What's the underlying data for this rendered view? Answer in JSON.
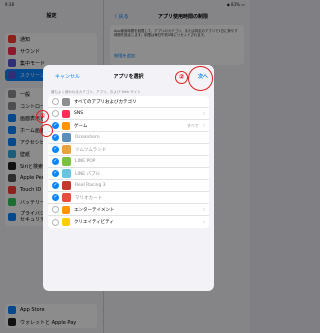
{
  "statusbar": {
    "time": "9:38",
    "right": "◆ 83% ▭"
  },
  "left": {
    "title": "設定",
    "group1": [
      {
        "label": "通知",
        "icon": "bell-icon",
        "color": "#ff3b30"
      },
      {
        "label": "サウンド",
        "icon": "speaker-icon",
        "color": "#ff2d55"
      },
      {
        "label": "集中モード",
        "icon": "moon-icon",
        "color": "#5856d6"
      },
      {
        "label": "スクリーンタイム",
        "icon": "hourglass-icon",
        "color": "#5856d6"
      }
    ],
    "group2": [
      {
        "label": "一般",
        "icon": "gear-icon",
        "color": "#8e8e93"
      },
      {
        "label": "コントロールセンター",
        "icon": "switches-icon",
        "color": "#8e8e93"
      },
      {
        "label": "画面表示と明るさ",
        "icon": "aa-icon",
        "color": "#0a84ff"
      },
      {
        "label": "ホーム画面とDock",
        "icon": "grid-icon",
        "color": "#0a84ff"
      },
      {
        "label": "アクセシビリティ",
        "icon": "person-icon",
        "color": "#0a84ff"
      },
      {
        "label": "壁紙",
        "icon": "flower-icon",
        "color": "#34aadc"
      },
      {
        "label": "Siriと検索",
        "icon": "siri-icon",
        "color": "#222222"
      },
      {
        "label": "Apple Pencil",
        "icon": "pencil-icon",
        "color": "#555555"
      },
      {
        "label": "Touch ID",
        "icon": "fingerprint-icon",
        "color": "#ff3b30"
      },
      {
        "label": "バッテリー",
        "icon": "battery-icon",
        "color": "#34c759"
      },
      {
        "label": "プライバシーと\nセキュリティ",
        "icon": "hand-icon",
        "color": "#0a84ff"
      }
    ],
    "group3": [
      {
        "label": "App Store",
        "icon": "appstore-icon",
        "color": "#0a84ff"
      },
      {
        "label": "ウォレットと Apple Pay",
        "icon": "wallet-icon",
        "color": "#222222"
      }
    ]
  },
  "right": {
    "back": "〈 戻る",
    "title": "アプリ使用時間の制限",
    "desc": "App使用時間を制限して、アプリのカテゴリ、または特定のアプリで1日に費やす時間を設定します。制限は毎日午前0時にリセットされます。",
    "add": "制限を追加"
  },
  "modal": {
    "cancel": "キャンセル",
    "title": "アプリを選択",
    "next": "次へ",
    "note": "最もよく使われるカテゴリ、アプリ、および Web サイト",
    "rows": [
      {
        "label": "すべてのアプリおよびカテゴリ",
        "checked": false,
        "icon": "stack-icon",
        "color": "#8e8e93",
        "sub": false,
        "value": "",
        "chev": false,
        "gray": false
      },
      {
        "label": "SNS",
        "checked": false,
        "icon": "chat-icon",
        "color": "#ff2d55",
        "sub": false,
        "value": "",
        "chev": true,
        "gray": false
      },
      {
        "label": "ゲーム",
        "checked": true,
        "icon": "rocket-icon",
        "color": "#ff9500",
        "sub": false,
        "value": "すべて",
        "chev": true,
        "gray": false
      },
      {
        "label": "Oceanhorn",
        "checked": true,
        "icon": "game-icon",
        "color": "#5b8fb9",
        "sub": true,
        "value": "",
        "chev": false,
        "gray": true
      },
      {
        "label": "ツムツムランド",
        "checked": true,
        "icon": "game-icon",
        "color": "#e6a23c",
        "sub": true,
        "value": "",
        "chev": false,
        "gray": true
      },
      {
        "label": "LINE POP",
        "checked": true,
        "icon": "game-icon",
        "color": "#7bc043",
        "sub": true,
        "value": "",
        "chev": false,
        "gray": true
      },
      {
        "label": "LINE バブル",
        "checked": true,
        "icon": "game-icon",
        "color": "#6cc3e0",
        "sub": true,
        "value": "",
        "chev": false,
        "gray": true
      },
      {
        "label": "Real Racing 3",
        "checked": true,
        "icon": "game-icon",
        "color": "#c0392b",
        "sub": true,
        "value": "",
        "chev": false,
        "gray": true
      },
      {
        "label": "マリオカート",
        "checked": true,
        "icon": "game-icon",
        "color": "#e74c3c",
        "sub": true,
        "value": "",
        "chev": false,
        "gray": true
      },
      {
        "label": "エンターテイメント",
        "checked": false,
        "icon": "popcorn-icon",
        "color": "#ff9500",
        "sub": false,
        "value": "",
        "chev": true,
        "gray": false
      },
      {
        "label": "クリエイティビティ",
        "checked": false,
        "icon": "brush-icon",
        "color": "#ffcc00",
        "sub": false,
        "value": "",
        "chev": true,
        "gray": false
      }
    ]
  },
  "annotations": {
    "one": "①",
    "two": "②"
  },
  "colors": {
    "accent": "#0a84ff",
    "annotation": "#e0201f"
  }
}
